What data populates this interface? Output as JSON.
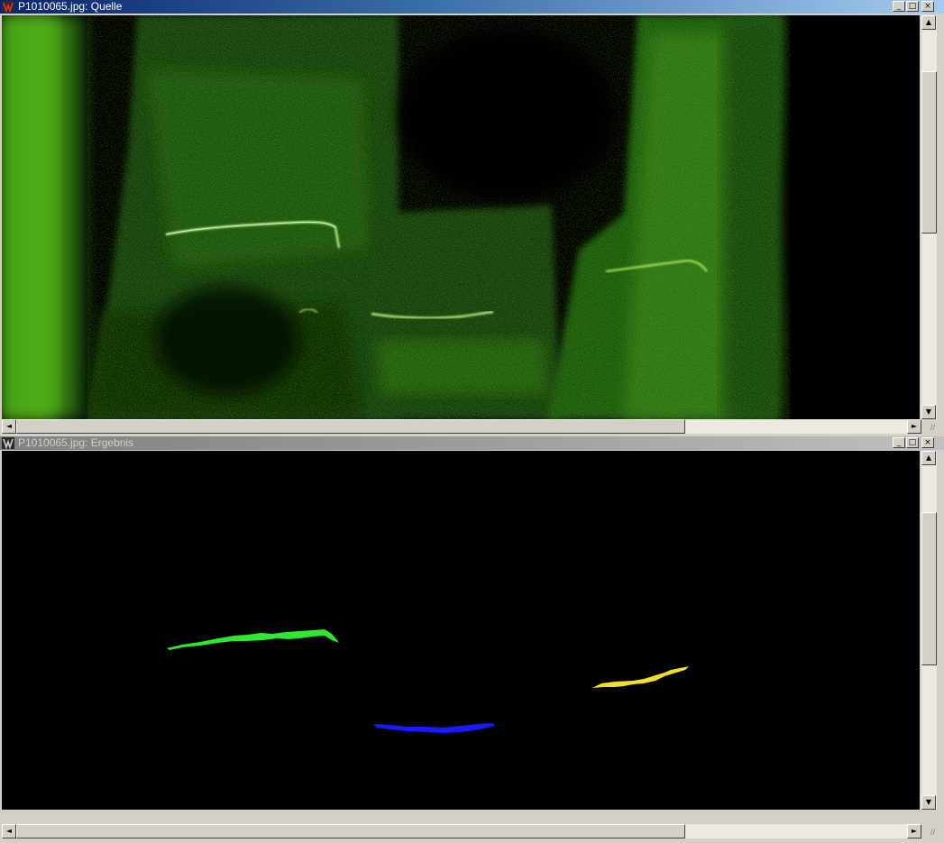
{
  "windows": [
    {
      "id": "top",
      "title": "P1010065.jpg: Quelle",
      "active": true,
      "buttons": {
        "minimize": "_",
        "maximize": "□",
        "close": "×"
      },
      "scroll": {
        "up": "▲",
        "down": "▼",
        "left": "◄",
        "right": "►",
        "grip": "//"
      }
    },
    {
      "id": "bottom",
      "title": "P1010065.jpg: Ergebnis",
      "active": false,
      "buttons": {
        "minimize": "_",
        "maximize": "□",
        "close": "×"
      },
      "scroll": {
        "up": "▲",
        "down": "▼",
        "left": "◄",
        "right": "►",
        "grip": "//"
      }
    }
  ],
  "images": {
    "source": {
      "content": "green fluorescent magnetic particle inspection photo of metal part with crack indications"
    },
    "result": {
      "blobs": [
        {
          "color": "#2ee82e"
        },
        {
          "color": "#1a1aff"
        },
        {
          "color": "#f0e02a"
        }
      ]
    }
  },
  "icons": {
    "app": "app-logo-icon",
    "resize": "resize-grip-icon"
  }
}
